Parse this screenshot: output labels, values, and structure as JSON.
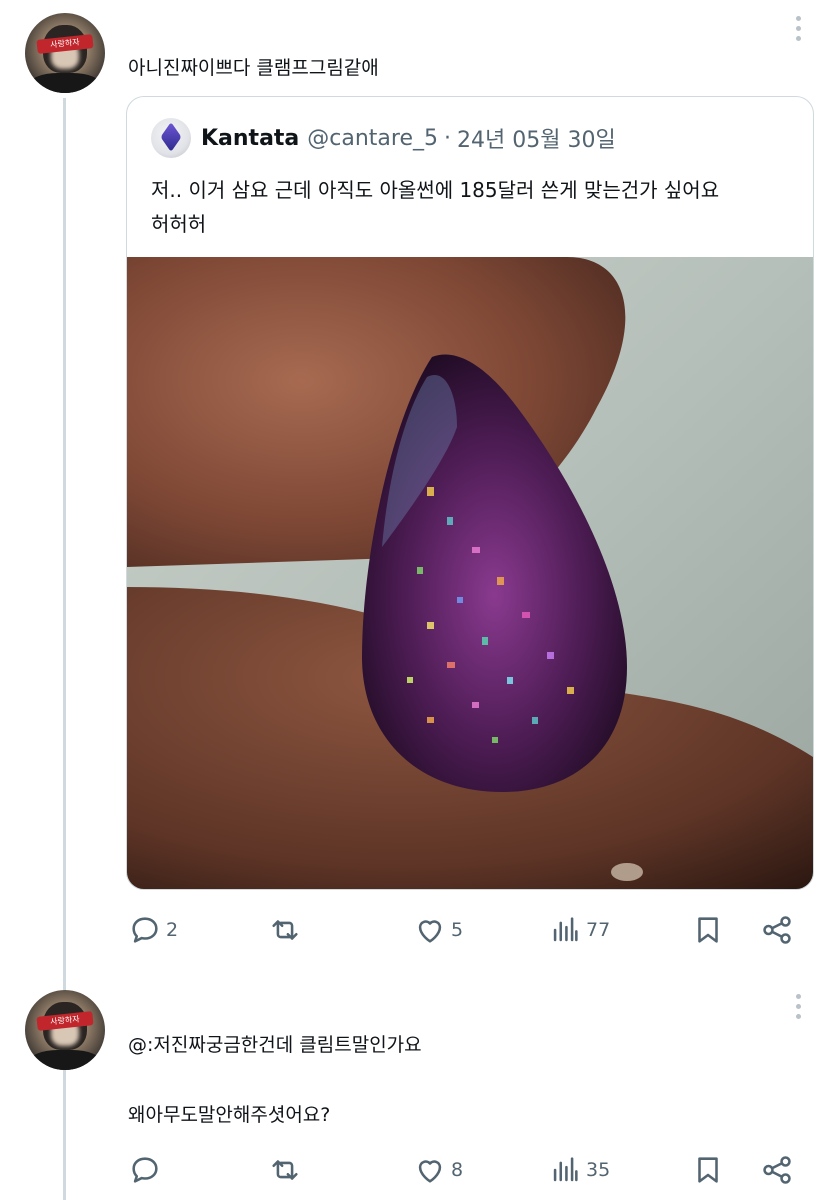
{
  "tweet1": {
    "avatar_text": "사랑하자",
    "text": "아니진짜이쁘다 클램프그림같애",
    "quote": {
      "name": "Kantata",
      "handle": "@cantare_5",
      "separator": "·",
      "date": "24년 05월 30일",
      "text_lines": [
        "저.. 이거 삼요 근데 아직도 아올썬에 185달러 쓴게 맞는건가 싶어요",
        "허허허"
      ]
    },
    "actions": {
      "reply_count": "2",
      "retweet_count": "",
      "like_count": "5",
      "view_count": "77"
    }
  },
  "tweet2": {
    "avatar_text": "사랑하자",
    "line1": "@:저진짜궁금한건데 클림트말인가요",
    "line2": "왜아무도말안해주셧어요?",
    "actions": {
      "reply_count": "",
      "retweet_count": "",
      "like_count": "8",
      "view_count": "35"
    }
  },
  "icons": {
    "reply": "reply-icon",
    "retweet": "retweet-icon",
    "like": "heart-icon",
    "views": "views-icon",
    "bookmark": "bookmark-icon",
    "share": "share-icon",
    "more": "more-vertical-icon"
  },
  "colors": {
    "icon_gray": "#536471",
    "text": "#0f1419",
    "border": "#cfd9de"
  }
}
